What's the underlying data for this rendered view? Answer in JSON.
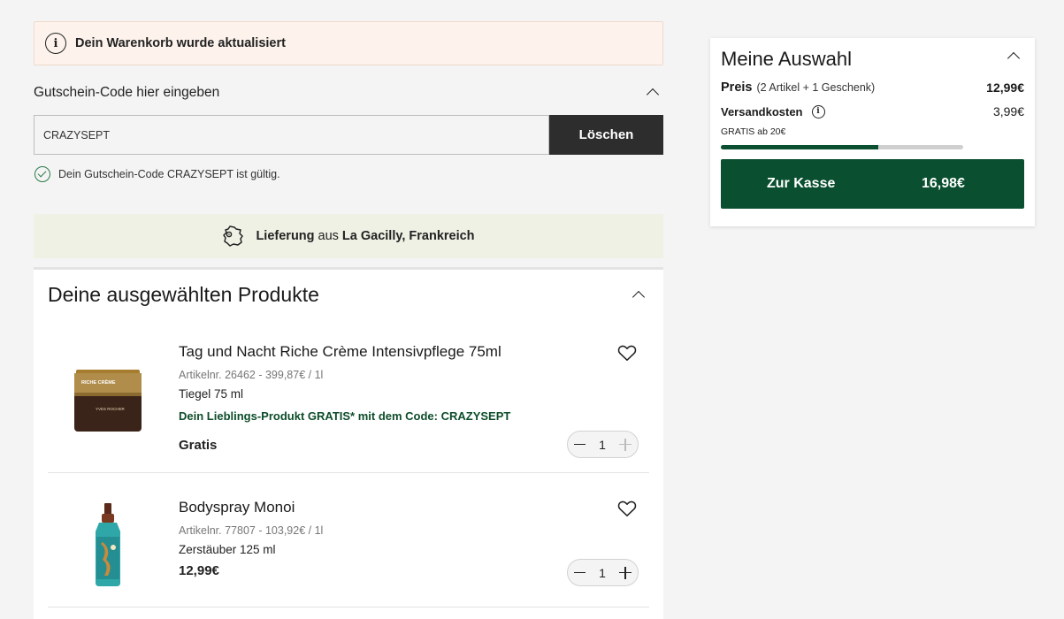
{
  "notice": {
    "text": "Dein Warenkorb wurde aktualisiert",
    "icon": "info-icon"
  },
  "coupon": {
    "label": "Gutschein-Code hier eingeben",
    "value": "CRAZYSEPT",
    "button": "Löschen",
    "valid_text": "Dein Gutschein-Code CRAZYSEPT ist gültig."
  },
  "delivery": {
    "bold1": "Lieferung",
    "mid": "aus",
    "bold2": "La Gacilly, Frankreich",
    "icon": "france-map-icon"
  },
  "products": {
    "title": "Deine ausgewählten Produkte",
    "items": [
      {
        "name": "Tag und Nacht Riche Crème Intensivpflege 75ml",
        "sku": "Artikelnr. 26462 - 399,87€ / 1l",
        "size": "Tiegel 75 ml",
        "promo": "Dein Lieblings-Produkt GRATIS* mit dem Code: CRAZYSEPT",
        "price": "Gratis",
        "qty": "1",
        "jar_label": "RICHE CRÈME",
        "brand": "YVES ROCHER"
      },
      {
        "name": "Bodyspray Monoi",
        "sku": "Artikelnr. 77807 - 103,92€ / 1l",
        "size": "Zerstäuber 125 ml",
        "price": "12,99€",
        "qty": "1"
      }
    ]
  },
  "summary": {
    "title": "Meine Auswahl",
    "price_label": "Preis",
    "price_sub": "(2 Artikel + 1 Geschenk)",
    "price_value": "12,99€",
    "shipping_label": "Versandkosten",
    "shipping_value": "3,99€",
    "free_label": "GRATIS ab 20€",
    "progress_fraction": 0.65,
    "checkout_label": "Zur Kasse",
    "checkout_value": "16,98€"
  },
  "colors": {
    "brand_green": "#0a4f2f",
    "notice_bg": "#fdf3ec",
    "delivery_bg": "#eef1e4",
    "dark_button": "#2d2d2d"
  }
}
